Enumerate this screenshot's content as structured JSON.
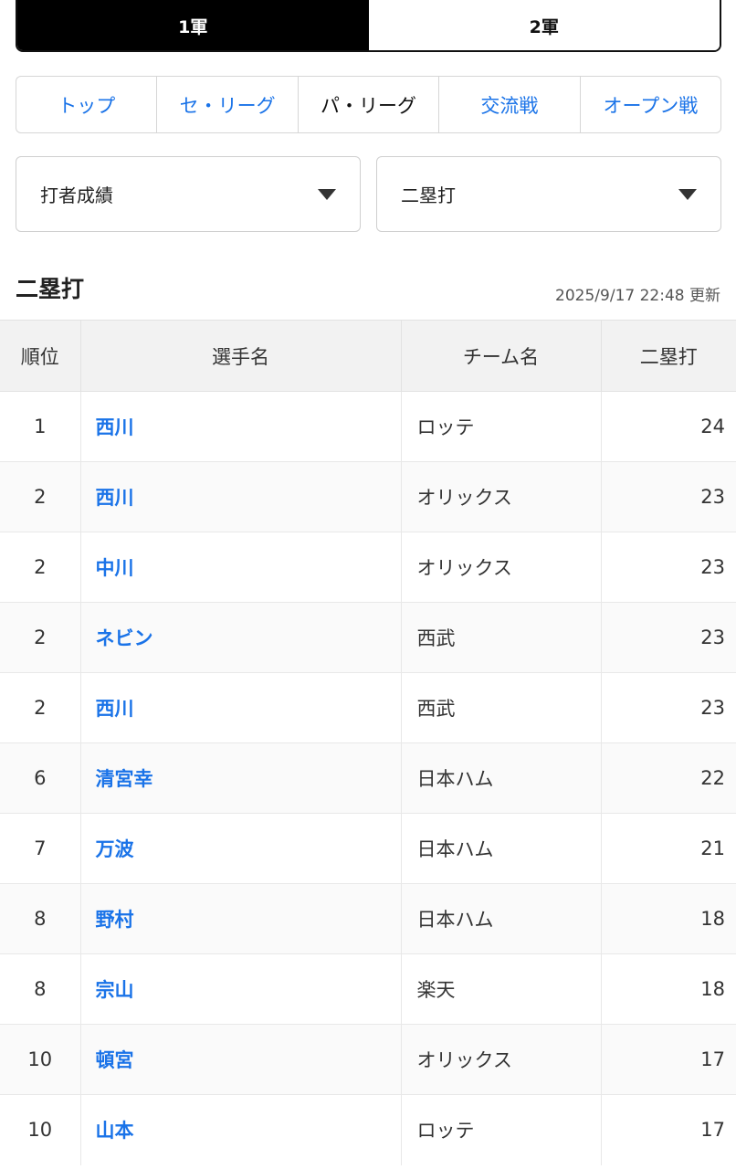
{
  "squad_toggle": [
    {
      "label": "1軍",
      "active": true
    },
    {
      "label": "2軍",
      "active": false
    }
  ],
  "league_tabs": [
    {
      "label": "トップ",
      "active": false
    },
    {
      "label": "セ・リーグ",
      "active": false
    },
    {
      "label": "パ・リーグ",
      "active": true
    },
    {
      "label": "交流戦",
      "active": false
    },
    {
      "label": "オープン戦",
      "active": false
    }
  ],
  "selectors": {
    "category": "打者成績",
    "stat": "二塁打"
  },
  "section": {
    "title": "二塁打",
    "updated": "2025/9/17 22:48 更新"
  },
  "table": {
    "headers": [
      "順位",
      "選手名",
      "チーム名",
      "二塁打"
    ],
    "rows": [
      {
        "rank": "1",
        "player": "西川",
        "team": "ロッテ",
        "value": "24"
      },
      {
        "rank": "2",
        "player": "西川",
        "team": "オリックス",
        "value": "23"
      },
      {
        "rank": "2",
        "player": "中川",
        "team": "オリックス",
        "value": "23"
      },
      {
        "rank": "2",
        "player": "ネビン",
        "team": "西武",
        "value": "23"
      },
      {
        "rank": "2",
        "player": "西川",
        "team": "西武",
        "value": "23"
      },
      {
        "rank": "6",
        "player": "清宮幸",
        "team": "日本ハム",
        "value": "22"
      },
      {
        "rank": "7",
        "player": "万波",
        "team": "日本ハム",
        "value": "21"
      },
      {
        "rank": "8",
        "player": "野村",
        "team": "日本ハム",
        "value": "18"
      },
      {
        "rank": "8",
        "player": "宗山",
        "team": "楽天",
        "value": "18"
      },
      {
        "rank": "10",
        "player": "頓宮",
        "team": "オリックス",
        "value": "17"
      },
      {
        "rank": "10",
        "player": "山本",
        "team": "ロッテ",
        "value": "17"
      }
    ]
  },
  "colors": {
    "link": "#1a73e8",
    "active_toggle_bg": "#000000",
    "header_bg": "#f2f2f2"
  }
}
